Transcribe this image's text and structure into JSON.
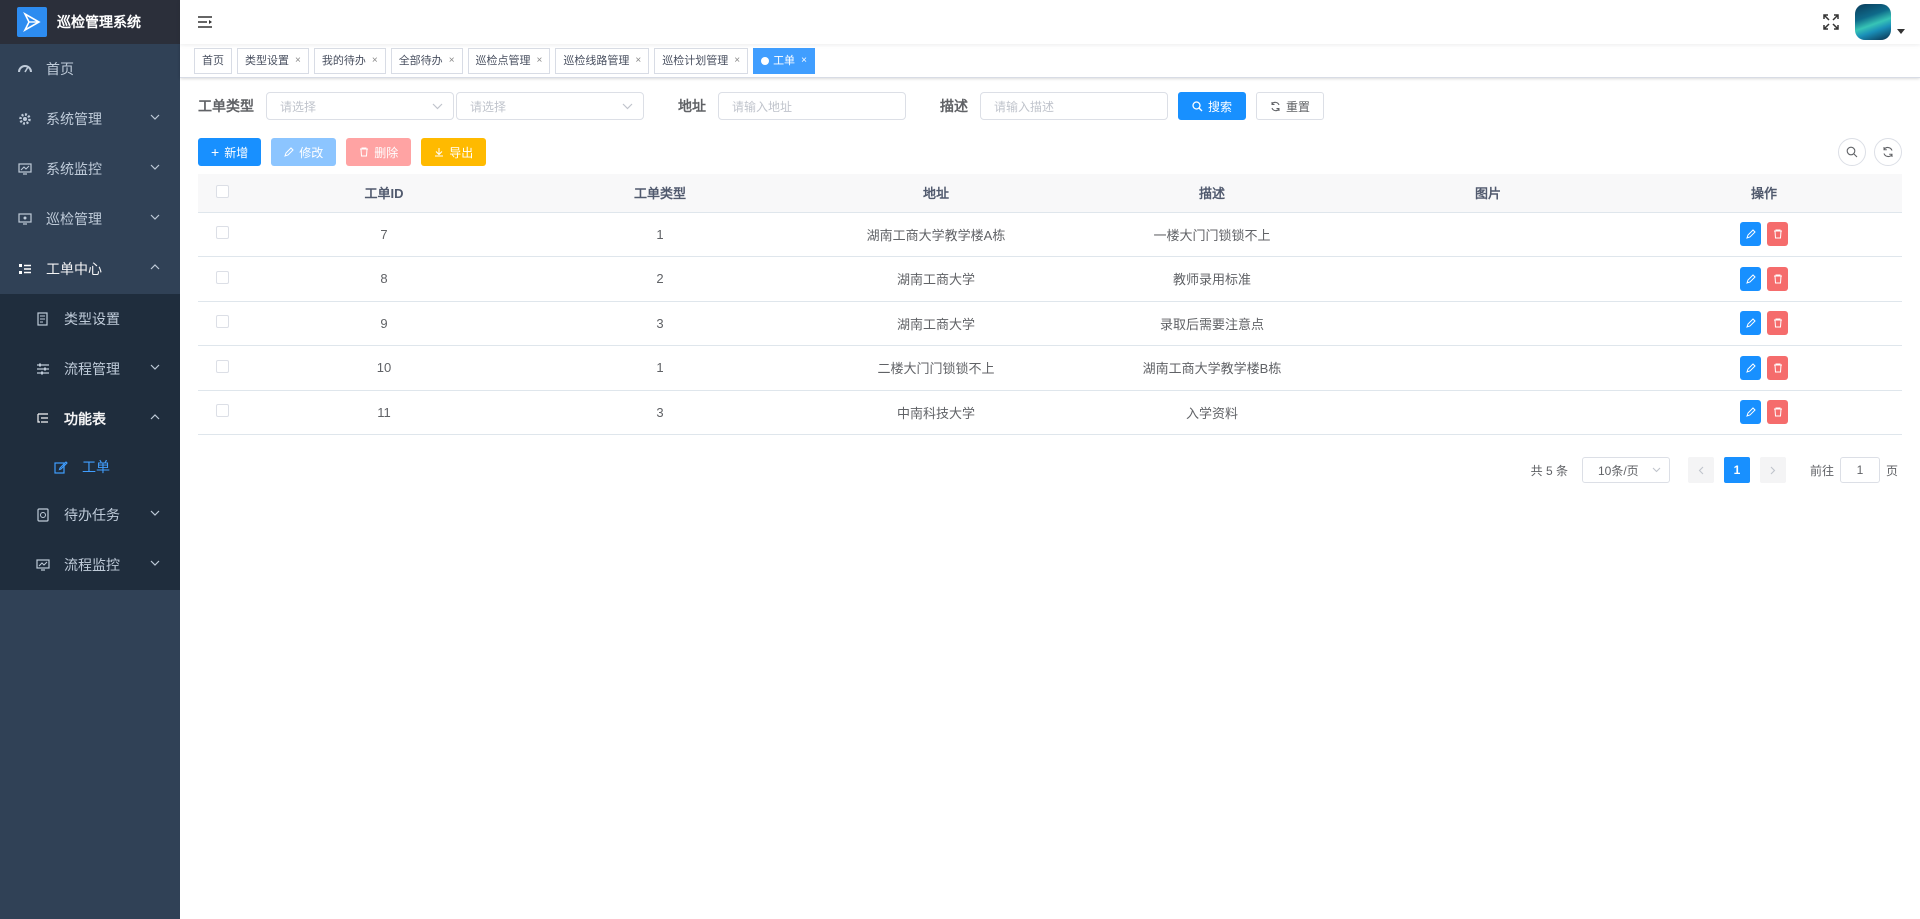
{
  "app": {
    "title": "巡检管理系统"
  },
  "sidebar": {
    "home": "首页",
    "system_manage": "系统管理",
    "system_monitor": "系统监控",
    "patrol_manage": "巡检管理",
    "work_order_center": "工单中心",
    "type_settings": "类型设置",
    "process_manage": "流程管理",
    "function_table": "功能表",
    "work_order": "工单",
    "todo_tasks": "待办任务",
    "process_monitor": "流程监控"
  },
  "tags": [
    {
      "label": "首页"
    },
    {
      "label": "类型设置"
    },
    {
      "label": "我的待办"
    },
    {
      "label": "全部待办"
    },
    {
      "label": "巡检点管理"
    },
    {
      "label": "巡检线路管理"
    },
    {
      "label": "巡检计划管理"
    },
    {
      "label": "工单"
    }
  ],
  "search": {
    "type_label": "工单类型",
    "type_placeholder_1": "请选择",
    "type_placeholder_2": "请选择",
    "address_label": "地址",
    "address_placeholder": "请输入地址",
    "desc_label": "描述",
    "desc_placeholder": "请输入描述",
    "search_btn": "搜索",
    "reset_btn": "重置"
  },
  "toolbar": {
    "add": "新增",
    "edit": "修改",
    "delete": "删除",
    "export": "导出"
  },
  "table": {
    "headers": {
      "id": "工单ID",
      "type": "工单类型",
      "address": "地址",
      "desc": "描述",
      "image": "图片",
      "ops": "操作"
    },
    "rows": [
      {
        "id": "7",
        "type": "1",
        "address": "湖南工商大学教学楼A栋",
        "desc": "一楼大门门锁锁不上"
      },
      {
        "id": "8",
        "type": "2",
        "address": "湖南工商大学",
        "desc": "教师录用标准"
      },
      {
        "id": "9",
        "type": "3",
        "address": "湖南工商大学",
        "desc": "录取后需要注意点"
      },
      {
        "id": "10",
        "type": "1",
        "address": "二楼大门门锁锁不上",
        "desc": "湖南工商大学教学楼B栋"
      },
      {
        "id": "11",
        "type": "3",
        "address": "中南科技大学",
        "desc": "入学资料"
      }
    ]
  },
  "pager": {
    "total": "共 5 条",
    "page_size": "10条/页",
    "current": "1",
    "goto_prefix": "前往",
    "goto_value": "1",
    "goto_suffix": "页"
  }
}
